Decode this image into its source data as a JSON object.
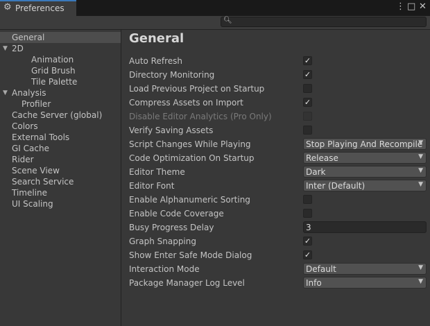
{
  "window": {
    "tab_title": "Preferences",
    "tab_icon": "gear-icon",
    "controls": {
      "menu": "⋮",
      "maximize": "□",
      "close": "✕"
    }
  },
  "search": {
    "value": "",
    "placeholder": ""
  },
  "sidebar": {
    "items": [
      {
        "label": "General",
        "selected": true,
        "indent": 0,
        "foldout": ""
      },
      {
        "label": "2D",
        "indent": 0,
        "foldout": "▼"
      },
      {
        "label": "Animation",
        "indent": 2,
        "foldout": ""
      },
      {
        "label": "Grid Brush",
        "indent": 2,
        "foldout": ""
      },
      {
        "label": "Tile Palette",
        "indent": 2,
        "foldout": ""
      },
      {
        "label": "Analysis",
        "indent": 0,
        "foldout": "▼"
      },
      {
        "label": "Profiler",
        "indent": 1,
        "foldout": ""
      },
      {
        "label": "Cache Server (global)",
        "indent": 0,
        "foldout": ""
      },
      {
        "label": "Colors",
        "indent": 0,
        "foldout": ""
      },
      {
        "label": "External Tools",
        "indent": 0,
        "foldout": ""
      },
      {
        "label": "GI Cache",
        "indent": 0,
        "foldout": ""
      },
      {
        "label": "Rider",
        "indent": 0,
        "foldout": ""
      },
      {
        "label": "Scene View",
        "indent": 0,
        "foldout": ""
      },
      {
        "label": "Search Service",
        "indent": 0,
        "foldout": ""
      },
      {
        "label": "Timeline",
        "indent": 0,
        "foldout": ""
      },
      {
        "label": "UI Scaling",
        "indent": 0,
        "foldout": ""
      }
    ]
  },
  "main": {
    "title": "General",
    "settings": [
      {
        "label": "Auto Refresh",
        "type": "checkbox",
        "checked": true
      },
      {
        "label": "Directory Monitoring",
        "type": "checkbox",
        "checked": true
      },
      {
        "label": "Load Previous Project on Startup",
        "type": "checkbox",
        "checked": false
      },
      {
        "label": "Compress Assets on Import",
        "type": "checkbox",
        "checked": true
      },
      {
        "label": "Disable Editor Analytics (Pro Only)",
        "type": "checkbox",
        "checked": false,
        "disabled": true
      },
      {
        "label": "Verify Saving Assets",
        "type": "checkbox",
        "checked": false
      },
      {
        "label": "Script Changes While Playing",
        "type": "dropdown",
        "value": "Stop Playing And Recompile"
      },
      {
        "label": "Code Optimization On Startup",
        "type": "dropdown",
        "value": "Release"
      },
      {
        "label": "Editor Theme",
        "type": "dropdown",
        "value": "Dark"
      },
      {
        "label": "Editor Font",
        "type": "dropdown",
        "value": "Inter (Default)"
      },
      {
        "label": "Enable Alphanumeric Sorting",
        "type": "checkbox",
        "checked": false
      },
      {
        "label": "Enable Code Coverage",
        "type": "checkbox",
        "checked": false
      },
      {
        "label": "Busy Progress Delay",
        "type": "number",
        "value": "3"
      },
      {
        "label": "Graph Snapping",
        "type": "checkbox",
        "checked": true
      },
      {
        "label": "Show Enter Safe Mode Dialog",
        "type": "checkbox",
        "checked": true
      },
      {
        "label": "Interaction Mode",
        "type": "dropdown",
        "value": "Default"
      },
      {
        "label": "Package Manager Log Level",
        "type": "dropdown",
        "value": "Info"
      }
    ]
  },
  "colors": {
    "background": "#383838",
    "tab_accent": "#3a79bb",
    "selection": "#4d4d4d"
  }
}
